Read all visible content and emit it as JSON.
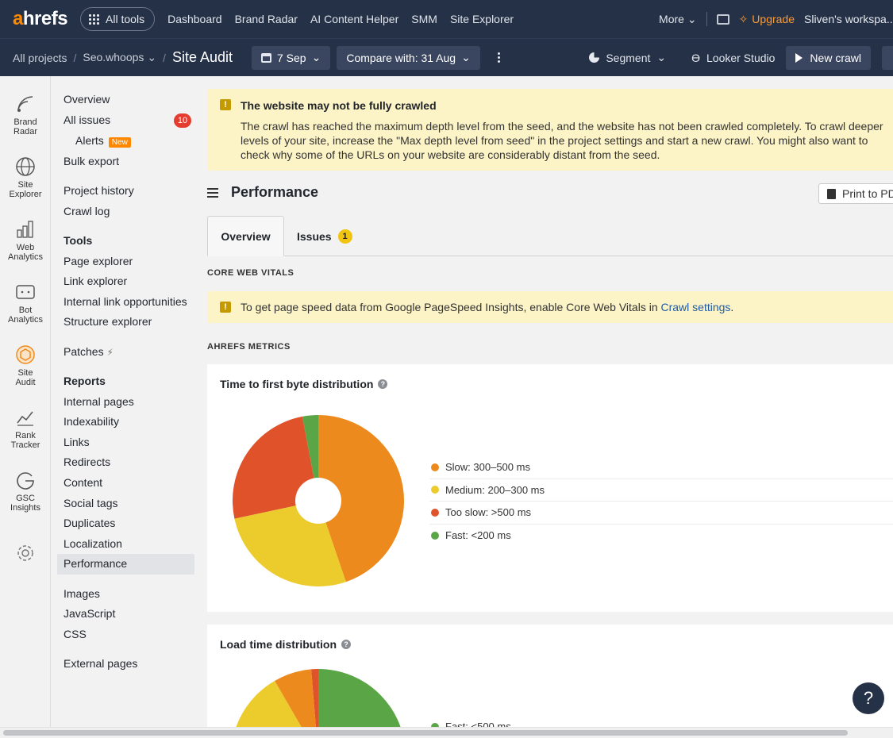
{
  "topnav": {
    "logo_a": "a",
    "logo_rest": "hrefs",
    "all_tools": "All tools",
    "links": [
      "Dashboard",
      "Brand Radar",
      "AI Content Helper",
      "SMM",
      "Site Explorer"
    ],
    "more": "More",
    "upgrade": "Upgrade",
    "workspace": "Sliven's workspa..."
  },
  "subbar": {
    "crumb_root": "All projects",
    "crumb_project": "Seo.whoops",
    "crumb_current": "Site Audit",
    "date": "7 Sep",
    "compare": "Compare with: 31 Aug",
    "segment": "Segment",
    "looker": "Looker Studio",
    "new_crawl": "New crawl"
  },
  "rail": [
    {
      "label": "Brand Radar",
      "icon": "brand-radar-icon"
    },
    {
      "label": "Site Explorer",
      "icon": "globe-icon"
    },
    {
      "label": "Web Analytics",
      "icon": "web-analytics-icon"
    },
    {
      "label": "Bot Analytics",
      "icon": "bot-icon"
    },
    {
      "label": "Site Audit",
      "icon": "site-audit-icon"
    },
    {
      "label": "Rank Tracker",
      "icon": "rank-tracker-icon"
    },
    {
      "label": "GSC Insights",
      "icon": "gsc-icon"
    },
    {
      "label": "",
      "icon": "gear-icon"
    }
  ],
  "sidemenu": {
    "overview": "Overview",
    "all_issues": "All issues",
    "all_issues_count": "10",
    "alerts": "Alerts",
    "alerts_tag": "New",
    "bulk_export": "Bulk export",
    "project_history": "Project history",
    "crawl_log": "Crawl log",
    "tools_head": "Tools",
    "page_explorer": "Page explorer",
    "link_explorer": "Link explorer",
    "internal_link_opps": "Internal link opportunities",
    "structure_explorer": "Structure explorer",
    "patches": "Patches",
    "reports_head": "Reports",
    "internal_pages": "Internal pages",
    "indexability": "Indexability",
    "links": "Links",
    "redirects": "Redirects",
    "content": "Content",
    "social_tags": "Social tags",
    "duplicates": "Duplicates",
    "localization": "Localization",
    "performance": "Performance",
    "images": "Images",
    "javascript": "JavaScript",
    "css": "CSS",
    "external_pages": "External pages"
  },
  "warning": {
    "title": "The website may not be fully crawled",
    "body": "The crawl has reached the maximum depth level from the seed, and the website has not been crawled completely. To crawl deeper levels of your site, increase the \"Max depth level from seed\" in the project settings and start a new crawl. You might also want to check why some of the URLs on your website are considerably distant from the seed."
  },
  "page": {
    "title": "Performance",
    "print": "Print to PDF",
    "tab_overview": "Overview",
    "tab_issues": "Issues",
    "tab_issues_count": "1",
    "cwv_label": "CORE WEB VITALS",
    "cwv_text": "To get page speed data from Google PageSpeed Insights, enable Core Web Vitals in ",
    "cwv_link": "Crawl settings",
    "cwv_end": ".",
    "metrics_label": "AHREFS METRICS"
  },
  "ttfb": {
    "title": "Time to first byte distribution",
    "legend": [
      {
        "label": "Slow: 300–500 ms",
        "value": "30",
        "color": "#ec8a1e"
      },
      {
        "label": "Medium: 200–300 ms",
        "value": "18",
        "color": "#eccb2d"
      },
      {
        "label": "Too slow: >500 ms",
        "value": "17",
        "color": "#e0522a"
      },
      {
        "label": "Fast: <200 ms",
        "value": "2",
        "color": "#5aa647"
      }
    ]
  },
  "load": {
    "title": "Load time distribution",
    "first_legend": "Fast: <500 ms"
  },
  "chart_data": {
    "type": "pie",
    "title": "Time to first byte distribution",
    "categories": [
      "Slow: 300–500 ms",
      "Medium: 200–300 ms",
      "Too slow: >500 ms",
      "Fast: <200 ms"
    ],
    "values": [
      30,
      18,
      17,
      2
    ]
  }
}
